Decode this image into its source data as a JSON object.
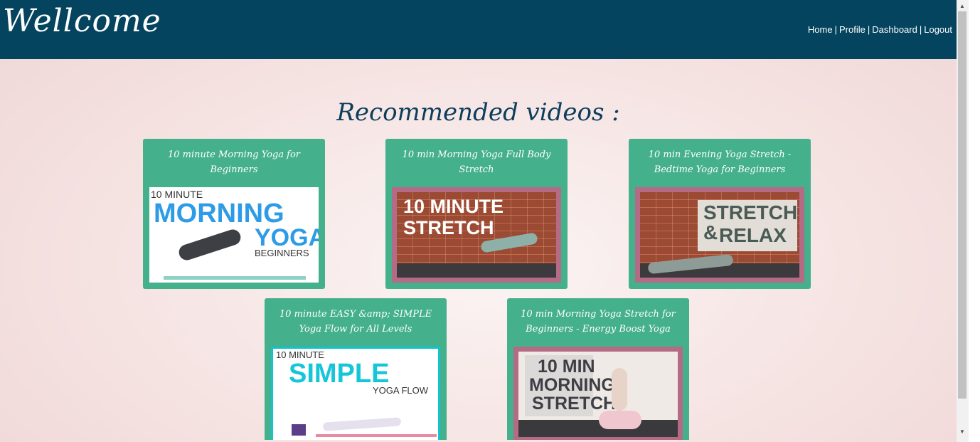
{
  "header": {
    "brand": "Wellcome",
    "nav": [
      {
        "label": "Home"
      },
      {
        "label": "Profile"
      },
      {
        "label": "Dashboard"
      },
      {
        "label": "Logout"
      }
    ],
    "separator": "|"
  },
  "main": {
    "title": "Recommended videos :",
    "videos": [
      {
        "title": "10 minute Morning Yoga for Beginners",
        "thumb_lines": [
          "10 MINUTE",
          "MORNING",
          "YOGA",
          "BEGINNERS"
        ]
      },
      {
        "title": "10 min Morning Yoga Full Body Stretch",
        "thumb_lines": [
          "10 MINUTE",
          "STRETCH"
        ]
      },
      {
        "title": "10 min Evening Yoga Stretch - Bedtime Yoga for Beginners",
        "thumb_lines": [
          "STRETCH &",
          "RELAX"
        ]
      },
      {
        "title": "10 minute EASY &amp; SIMPLE Yoga Flow for All Levels",
        "thumb_lines": [
          "10 MINUTE",
          "SIMPLE",
          "YOGA FLOW"
        ]
      },
      {
        "title": "10 min Morning Yoga Stretch for Beginners - Energy Boost Yoga",
        "thumb_lines": [
          "10 MIN",
          "MORNING",
          "STRETCH"
        ]
      }
    ]
  },
  "colors": {
    "header_bg": "#05445e",
    "card_bg": "#45b08c",
    "title_color": "#0c3e5c"
  }
}
